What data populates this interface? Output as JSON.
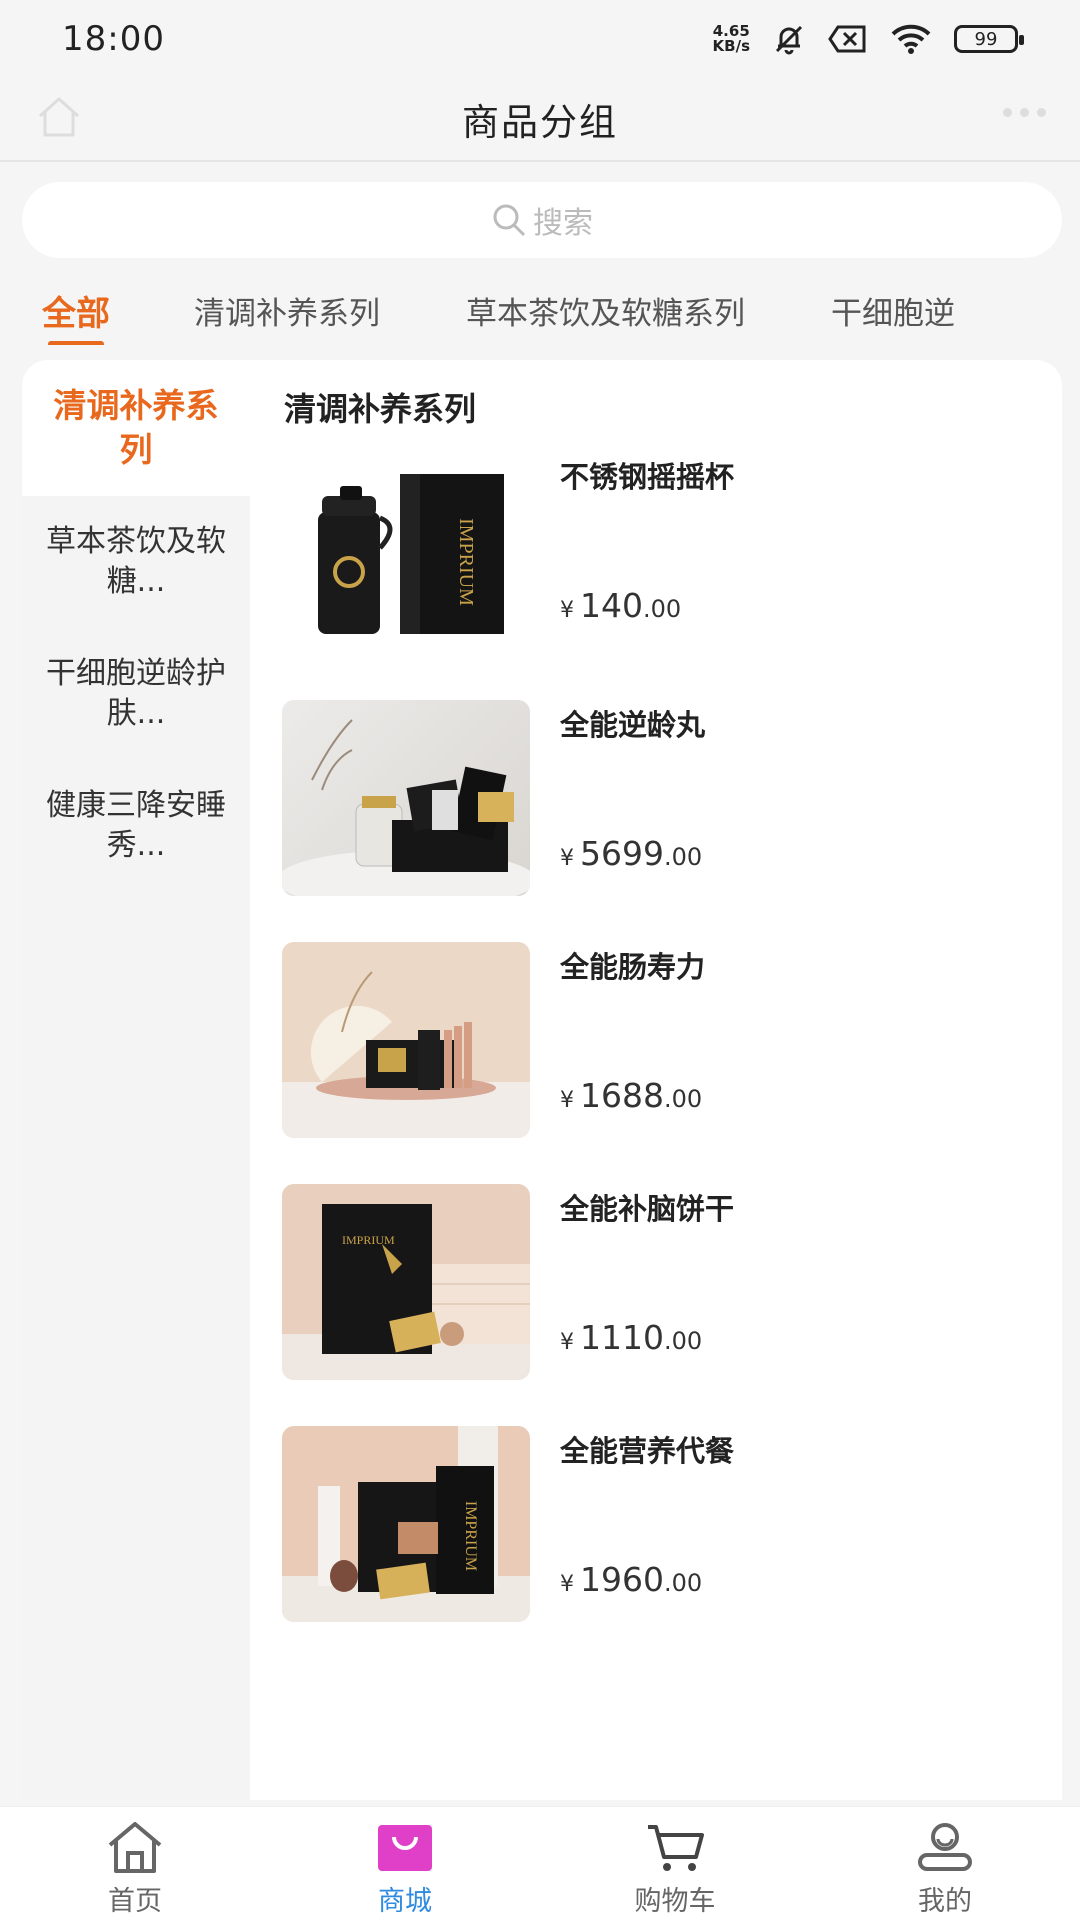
{
  "status_bar": {
    "time": "18:00",
    "net_speed_value": "4.65",
    "net_speed_unit": "KB/s",
    "battery": "99"
  },
  "header": {
    "title": "商品分组"
  },
  "search": {
    "placeholder": "搜索"
  },
  "tabs": [
    {
      "label": "全部",
      "active": true
    },
    {
      "label": "清调补养系列",
      "active": false
    },
    {
      "label": "草本茶饮及软糖系列",
      "active": false
    },
    {
      "label": "干细胞逆",
      "active": false
    }
  ],
  "sidebar": {
    "items": [
      {
        "label": "清调补养系列",
        "active": true
      },
      {
        "label": "草本茶饮及软糖...",
        "active": false
      },
      {
        "label": "干细胞逆龄护肤...",
        "active": false
      },
      {
        "label": "健康三降安睡秀...",
        "active": false
      }
    ]
  },
  "content": {
    "group_title": "清调补养系列",
    "currency": "¥",
    "products": [
      {
        "name": "不锈钢摇摇杯",
        "price_int": "140",
        "price_dec": ".00",
        "image": "shaker-cup-product-image"
      },
      {
        "name": "全能逆龄丸",
        "price_int": "5699",
        "price_dec": ".00",
        "image": "anti-aging-pill-product-image"
      },
      {
        "name": "全能肠寿力",
        "price_int": "1688",
        "price_dec": ".00",
        "image": "gut-health-product-image"
      },
      {
        "name": "全能补脑饼干",
        "price_int": "1110",
        "price_dec": ".00",
        "image": "brain-cookie-product-image"
      },
      {
        "name": "全能营养代餐",
        "price_int": "1960",
        "price_dec": ".00",
        "image": "meal-replacement-product-image"
      }
    ]
  },
  "tabbar": {
    "items": [
      {
        "label": "首页",
        "icon": "home-icon",
        "active": false
      },
      {
        "label": "商城",
        "icon": "shopping-bag-icon",
        "active": true
      },
      {
        "label": "购物车",
        "icon": "cart-icon",
        "active": false
      },
      {
        "label": "我的",
        "icon": "profile-icon",
        "active": false
      }
    ]
  },
  "colors": {
    "accent": "#e8691e",
    "tab_active": "#2f8be0",
    "mall_icon": "#e040c8"
  }
}
